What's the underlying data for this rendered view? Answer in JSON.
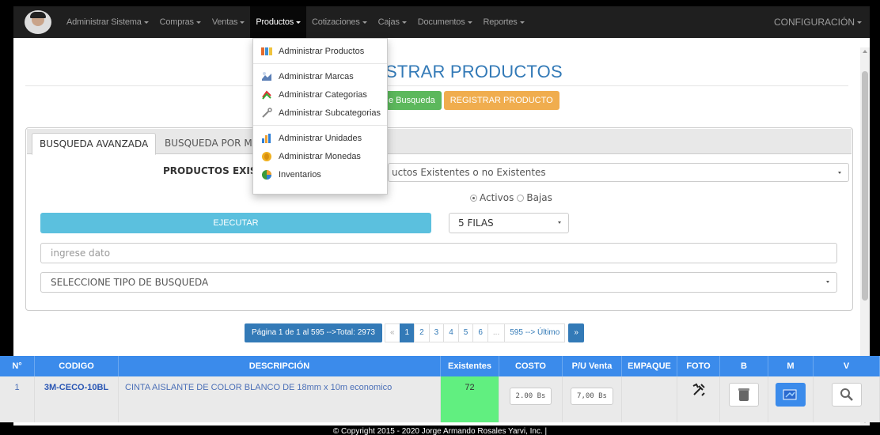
{
  "navbar": {
    "menus": [
      {
        "label": "Administrar Sistema"
      },
      {
        "label": "Compras"
      },
      {
        "label": "Ventas"
      },
      {
        "label": "Productos"
      },
      {
        "label": "Cotizaciones"
      },
      {
        "label": "Cajas"
      },
      {
        "label": "Documentos"
      },
      {
        "label": "Reportes"
      }
    ],
    "right_menu": "CONFIGURACIÓN"
  },
  "dropdown": {
    "items": [
      {
        "label": "Administrar Productos",
        "icon": "products-icon"
      },
      {
        "label": "Administrar Marcas",
        "icon": "brands-icon"
      },
      {
        "label": "Administrar Categorias",
        "icon": "categories-icon"
      },
      {
        "label": "Administrar Subcategorias",
        "icon": "subcategories-icon"
      },
      {
        "label": "Administrar Unidades",
        "icon": "units-icon"
      },
      {
        "label": "Administrar Monedas",
        "icon": "coins-icon"
      },
      {
        "label": "Inventarios",
        "icon": "inventory-icon"
      }
    ]
  },
  "page": {
    "title_visible": "STRAR PRODUCTOS",
    "btn_search_visible": "e Busqueda",
    "btn_register": "REGISTRAR PRODUCTO"
  },
  "search": {
    "tabs": [
      "BUSQUEDA AVANZADA",
      "BUSQUEDA POR MA"
    ],
    "existentes_label": "PRODUCTOS EXIS",
    "existentes_value": "uctos Existentes o no Existentes",
    "radio_activos": "Activos",
    "radio_bajas": "Bajas",
    "ejecutar": "EJECUTAR",
    "filas": "5 FILAS",
    "dato_placeholder": "ingrese dato",
    "tipo": "SELECCIONE TIPO DE BUSQUEDA"
  },
  "pagination": {
    "info": "Página 1 de 1 al 595 -->Total: 2973",
    "prev": "«",
    "pages": [
      "1",
      "2",
      "3",
      "4",
      "5",
      "6",
      "..."
    ],
    "last": "595 --> Último",
    "next": "»"
  },
  "table": {
    "headers": [
      "N°",
      "CODIGO",
      "DESCRIPCIÓN",
      "Existentes",
      "COSTO",
      "P/U Venta",
      "EMPAQUE",
      "FOTO",
      "B",
      "M",
      "V"
    ],
    "rows": [
      {
        "n": "1",
        "codigo": "3M-CECO-10BL",
        "descripcion": "CINTA AISLANTE DE COLOR BLANCO DE 18mm x 10m economico",
        "existentes": "72",
        "costo": "2.00 Bs",
        "pu_venta": "7,00 Bs",
        "empaque": ""
      }
    ]
  },
  "footer": "© Copyright 2015 - 2020 Jorge Armando Rosales Yarvi, Inc. |",
  "colors": {
    "navbar": "#1f1f1f",
    "primary": "#337ab7",
    "table_header": "#3b8beb",
    "success": "#5cb85c",
    "warning": "#f0ad4e",
    "info": "#5bc0de",
    "existentes_cell": "#61ef80"
  }
}
